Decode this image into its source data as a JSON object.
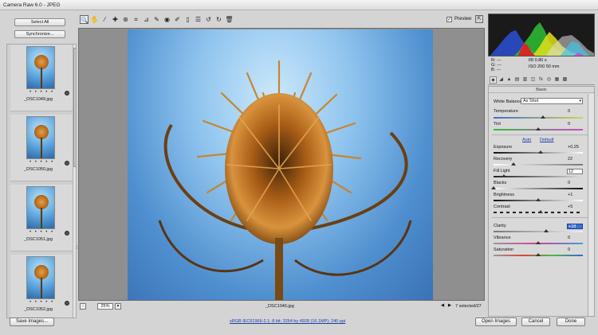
{
  "window": {
    "title": "Camera Raw 6.0  -  JPEG"
  },
  "filmstrip": {
    "select_all": "Select All",
    "synchronize": "Synchronize...",
    "items": [
      {
        "name": "_DSC1049.jpg",
        "rating": "• • • • •"
      },
      {
        "name": "_DSC1050.jpg",
        "rating": "• • • • •"
      },
      {
        "name": "_DSC1051.jpg",
        "rating": "• • • • •"
      },
      {
        "name": "_DSC1052.jpg",
        "rating": "• • • • •"
      }
    ],
    "splitter_glyph": "⁞"
  },
  "toolbar": {
    "tools": [
      {
        "name": "zoom-tool-icon",
        "glyph": "🔍"
      },
      {
        "name": "hand-tool-icon",
        "glyph": "✋"
      },
      {
        "name": "white-balance-tool-icon",
        "glyph": "⁄"
      },
      {
        "name": "color-sampler-tool-icon",
        "glyph": "✚"
      },
      {
        "name": "targeted-adjustment-tool-icon",
        "glyph": "⊛"
      },
      {
        "name": "crop-tool-icon",
        "glyph": "⌗"
      },
      {
        "name": "straighten-tool-icon",
        "glyph": "⊿"
      },
      {
        "name": "spot-removal-tool-icon",
        "glyph": "✎"
      },
      {
        "name": "red-eye-tool-icon",
        "glyph": "◉"
      },
      {
        "name": "adjustment-brush-icon",
        "glyph": "✐"
      },
      {
        "name": "graduated-filter-icon",
        "glyph": "▯"
      },
      {
        "name": "preferences-icon",
        "glyph": "☰"
      },
      {
        "name": "rotate-left-icon",
        "glyph": "↺"
      },
      {
        "name": "rotate-right-icon",
        "glyph": "↻"
      },
      {
        "name": "trash-icon",
        "glyph": "🗑"
      }
    ],
    "preview_label": "Preview",
    "preview_check": "✓",
    "fullscreen_glyph": "⇱"
  },
  "statusbar": {
    "zoom_minus": "-",
    "zoom_value": "25%",
    "zoom_plus": "▾",
    "filename": "_DSC1046.jpg",
    "prev": "◀",
    "next": "▶",
    "selection": "7 selected/27"
  },
  "readout": {
    "r": "R:  ---",
    "g": "G:  ---",
    "b": "B:  ---",
    "aperture_shutter": "f/8   0.80 s",
    "iso_focal": "ISO 200   50 mm"
  },
  "panel_tabs": [
    {
      "name": "basic-tab-icon",
      "glyph": "◉"
    },
    {
      "name": "tone-curve-tab-icon",
      "glyph": "◢"
    },
    {
      "name": "detail-tab-icon",
      "glyph": "▲"
    },
    {
      "name": "hsl-tab-icon",
      "glyph": "▤"
    },
    {
      "name": "split-toning-tab-icon",
      "glyph": "▥"
    },
    {
      "name": "lens-corrections-tab-icon",
      "glyph": "◫"
    },
    {
      "name": "effects-tab-icon",
      "glyph": "fx"
    },
    {
      "name": "camera-calibration-tab-icon",
      "glyph": "◎"
    },
    {
      "name": "presets-tab-icon",
      "glyph": "▦"
    },
    {
      "name": "snapshots-tab-icon",
      "glyph": "▩"
    }
  ],
  "basic": {
    "title": "Basic",
    "white_balance_label": "White Balance:",
    "white_balance_value": "As Shot",
    "white_balance_chevron": "▾",
    "auto": "Auto",
    "default": "Default",
    "sliders": [
      {
        "key": "temperature",
        "label": "Temperature",
        "value": "0",
        "level": 0.55
      },
      {
        "key": "tint",
        "label": "Tint",
        "value": "0",
        "level": 0.5
      },
      {
        "key": "exposure",
        "label": "Exposure",
        "value": "+0.25",
        "level": 0.53
      },
      {
        "key": "recovery",
        "label": "Recovery",
        "value": "22",
        "level": 0.22
      },
      {
        "key": "fill-light",
        "label": "Fill Light",
        "value": "12",
        "level": 0.12
      },
      {
        "key": "blacks",
        "label": "Blacks",
        "value": "0",
        "level": 0.0
      },
      {
        "key": "brightness",
        "label": "Brightness",
        "value": "+1",
        "level": 0.5
      },
      {
        "key": "contrast",
        "label": "Contrast",
        "value": "+5",
        "level": 0.53
      },
      {
        "key": "clarity",
        "label": "Clarity",
        "value": "+18",
        "level": 0.59
      },
      {
        "key": "vibrance",
        "label": "Vibrance",
        "value": "0",
        "level": 0.5
      },
      {
        "key": "saturation",
        "label": "Saturation",
        "value": "0",
        "level": 0.5
      }
    ]
  },
  "bottom": {
    "save": "Save Images...",
    "workflow": "sRGB IEC61966-2.1; 8 bit; 3264 by 4928 (16.1MP); 240 ppi",
    "open": "Open Images",
    "cancel": "Cancel",
    "done": "Done"
  },
  "colors": {
    "accent_link": "#1a3da8",
    "sky": "#5da6dd",
    "teasel": "#b86b1c"
  }
}
